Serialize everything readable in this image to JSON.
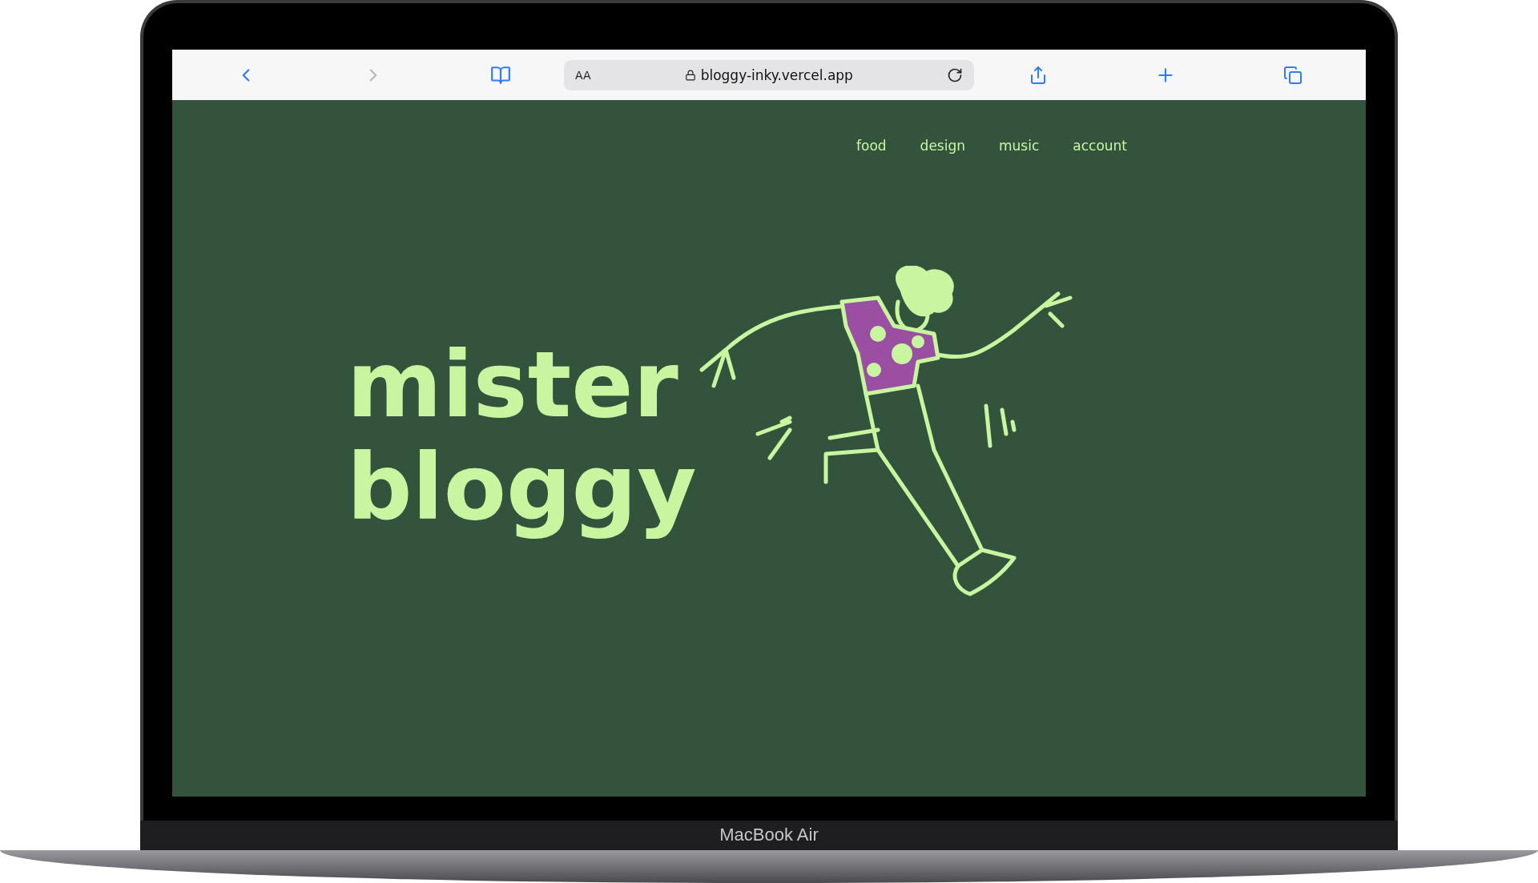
{
  "browser": {
    "reader_label": "AA",
    "url": "bloggy-inky.vercel.app"
  },
  "nav": [
    {
      "label": "food"
    },
    {
      "label": "design"
    },
    {
      "label": "music"
    },
    {
      "label": "account"
    }
  ],
  "hero": {
    "title_lines": [
      "mister",
      "bloggy"
    ]
  },
  "device_label": "MacBook Air"
}
